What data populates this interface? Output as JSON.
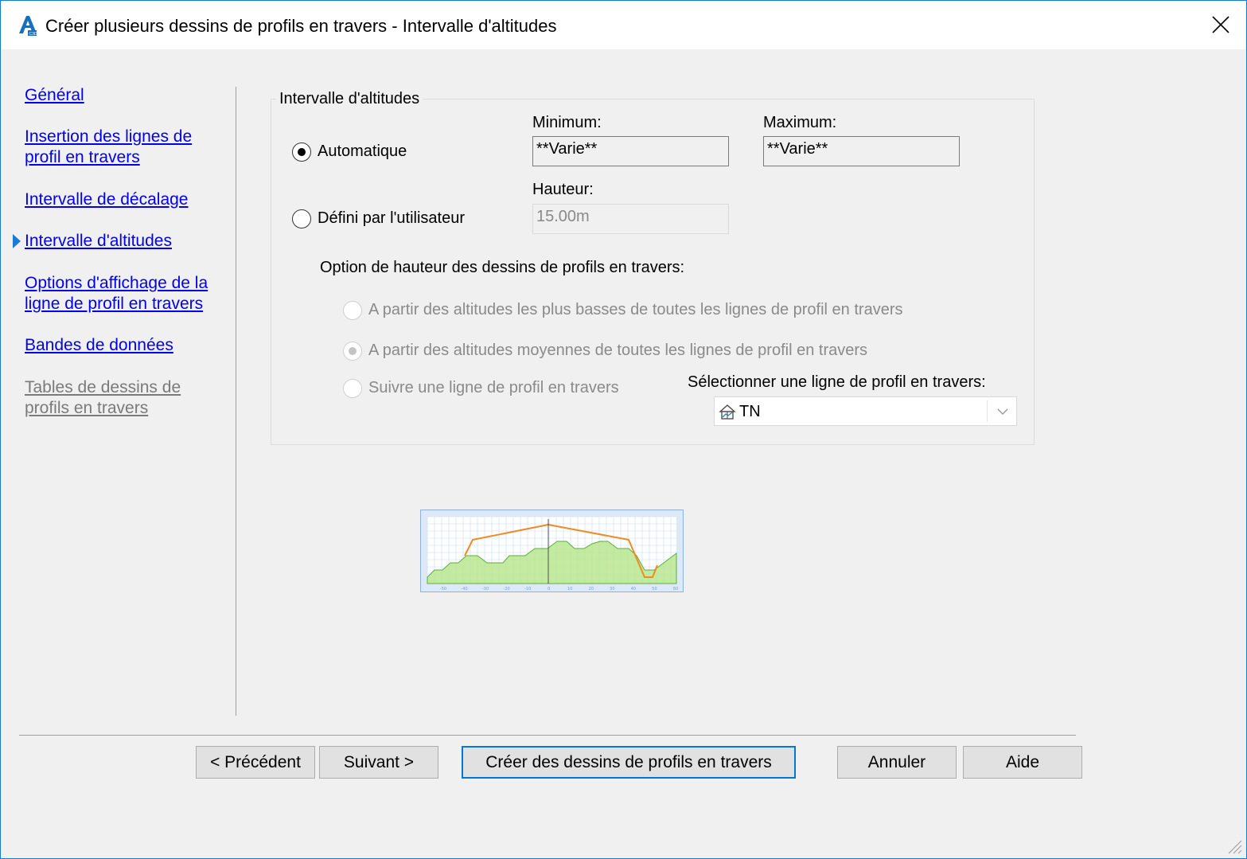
{
  "window": {
    "title": "Créer plusieurs dessins de profils en travers - Intervalle d'altitudes",
    "icon": "autocad-civil3d-icon",
    "accent": "#1979ca"
  },
  "nav": {
    "items": [
      {
        "label": "Général",
        "state": "link"
      },
      {
        "label": "Insertion des lignes de profil en travers",
        "state": "link"
      },
      {
        "label": "Intervalle de décalage",
        "state": "link"
      },
      {
        "label": "Intervalle d'altitudes",
        "state": "current"
      },
      {
        "label": "Options d'affichage de la ligne de profil en travers",
        "state": "link"
      },
      {
        "label": "Bandes de données",
        "state": "link"
      },
      {
        "label": "Tables de dessins de profils en travers",
        "state": "disabled"
      }
    ]
  },
  "group": {
    "title": "Intervalle d'altitudes",
    "automatic_label": "Automatique",
    "automatic_checked": true,
    "user_defined_label": "Défini par l'utilisateur",
    "user_defined_checked": false,
    "minimum_label": "Minimum:",
    "minimum_value": "**Varie**",
    "maximum_label": "Maximum:",
    "maximum_value": "**Varie**",
    "height_label": "Hauteur:",
    "height_value": "15.00m",
    "height_option_title": "Option de hauteur des dessins de profils en travers:",
    "options": [
      {
        "label": "A partir des altitudes les plus basses de toutes les lignes de profil en travers",
        "checked": false
      },
      {
        "label": "A partir des altitudes moyennes de toutes les lignes de profil en travers",
        "checked": true
      },
      {
        "label": "Suivre une ligne de profil en travers",
        "checked": false
      }
    ],
    "select_label": "Sélectionner une ligne de profil en travers:",
    "select_value": "TN",
    "select_icon": "surface-icon"
  },
  "preview": {
    "tick_labels": [
      "-50",
      "-40",
      "-30",
      "-20",
      "-10",
      "0",
      "10",
      "20",
      "30",
      "40",
      "50",
      "60"
    ],
    "ground_color": "#b8e68f",
    "design_color": "#f08a24"
  },
  "buttons": {
    "previous": "< Précédent",
    "next": "Suivant >",
    "create": "Créer des dessins de profils en travers",
    "cancel": "Annuler",
    "help": "Aide"
  }
}
